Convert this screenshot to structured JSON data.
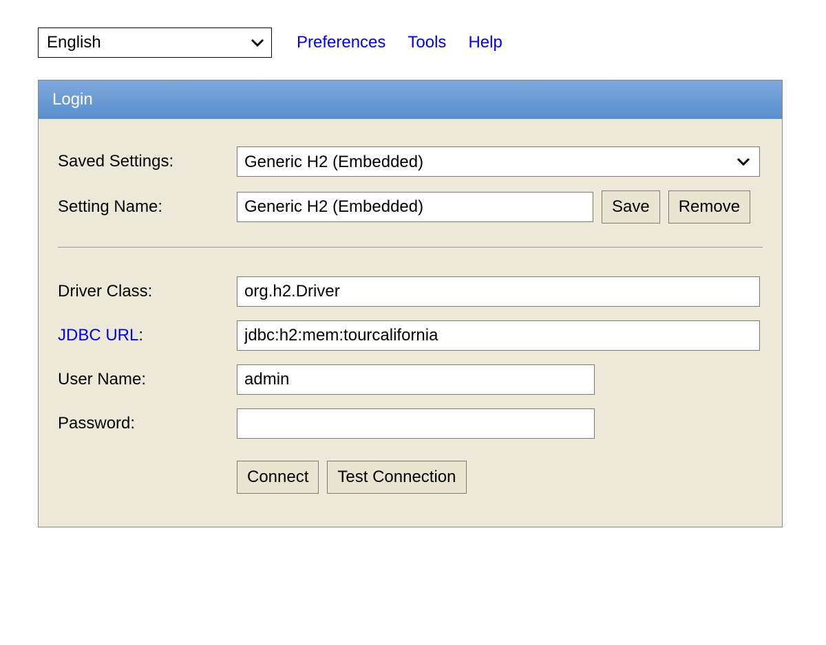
{
  "topbar": {
    "language_selected": "English",
    "links": {
      "preferences": "Preferences",
      "tools": "Tools",
      "help": "Help"
    }
  },
  "panel": {
    "title": "Login"
  },
  "form": {
    "saved_settings_label": "Saved Settings:",
    "saved_settings_value": "Generic H2 (Embedded)",
    "setting_name_label": "Setting Name:",
    "setting_name_value": "Generic H2 (Embedded)",
    "save_button": "Save",
    "remove_button": "Remove",
    "driver_class_label": "Driver Class:",
    "driver_class_value": "org.h2.Driver",
    "jdbc_url_label": "JDBC URL",
    "jdbc_url_colon": ":",
    "jdbc_url_value": "jdbc:h2:mem:tourcalifornia",
    "user_name_label": "User Name:",
    "user_name_value": "admin",
    "password_label": "Password:",
    "password_value": "",
    "connect_button": "Connect",
    "test_connection_button": "Test Connection"
  }
}
